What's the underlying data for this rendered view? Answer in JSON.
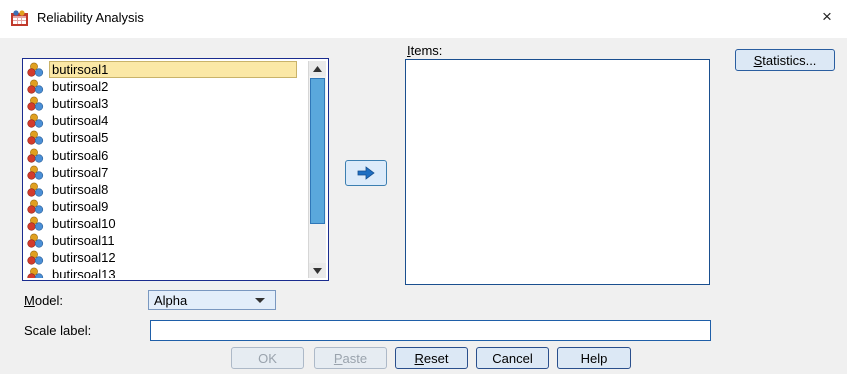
{
  "window": {
    "title": "Reliability Analysis",
    "close_glyph": "×",
    "app_icon": "spss-dialog-icon"
  },
  "variables": {
    "icon": "scale-variable-icon",
    "items": [
      {
        "label": "butirsoal1",
        "selected": true
      },
      {
        "label": "butirsoal2"
      },
      {
        "label": "butirsoal3"
      },
      {
        "label": "butirsoal4"
      },
      {
        "label": "butirsoal5"
      },
      {
        "label": "butirsoal6"
      },
      {
        "label": "butirsoal7"
      },
      {
        "label": "butirsoal8"
      },
      {
        "label": "butirsoal9"
      },
      {
        "label": "butirsoal10"
      },
      {
        "label": "butirsoal11"
      },
      {
        "label": "butirsoal12"
      },
      {
        "label": "butirsoal13"
      }
    ]
  },
  "move_button": {
    "icon": "right-arrow-icon"
  },
  "items_panel": {
    "label_mnemonic": "I",
    "label_rest": "tems:"
  },
  "statistics_button": {
    "mnemonic": "S",
    "rest": "tatistics..."
  },
  "model": {
    "label_mnemonic": "M",
    "label_rest": "odel:",
    "value": "Alpha"
  },
  "scale_label": {
    "label": "Scale label:",
    "value": ""
  },
  "buttons": {
    "ok": "OK",
    "paste": {
      "mnemonic": "P",
      "rest": "aste"
    },
    "reset": {
      "mnemonic": "R",
      "rest": "eset"
    },
    "cancel": "Cancel",
    "help": "Help"
  },
  "colors": {
    "accent_blue": "#5aa8dc",
    "selection": "#fbe8a6",
    "border_dark": "#1a2c8f"
  }
}
